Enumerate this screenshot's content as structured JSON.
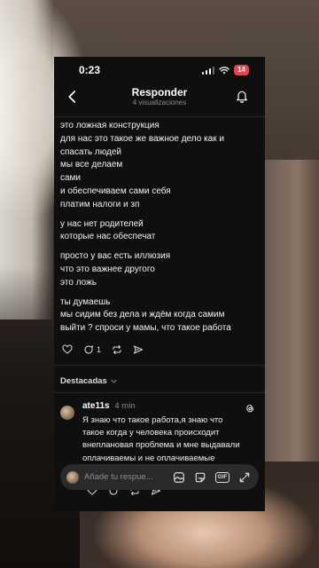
{
  "status_bar": {
    "time": "0:23",
    "battery": "14"
  },
  "header": {
    "title": "Responder",
    "subtitle": "4 visualizaciones"
  },
  "post": {
    "paragraphs": [
      [
        "это ложная конструкция",
        "для нас это такое же важное дело как и",
        "спасать людей",
        "мы все делаем",
        "сами",
        "и обеспечиваем сами себя",
        "платим налоги и зп"
      ],
      [
        "у нас нет родителей",
        "которые нас обеспечат"
      ],
      [
        "просто у вас есть иллюзия",
        "что это важнее другого",
        "это ложь"
      ],
      [
        "ты думаешь",
        "мы сидим без дела и ждём когда самим",
        "выйти ? спроси у мамы, что такое работа"
      ]
    ],
    "reply_count": "1"
  },
  "featured_label": "Destacadas",
  "reply": {
    "username": "ate11s",
    "time": "4 min",
    "text": "Я знаю что такое работа,я знаю что такое когда у человека происходит внеплановая проблема и мне выдавали оплачиваемы и не оплачиваемые выходные"
  },
  "composer": {
    "placeholder": "Añade tu respue...",
    "gif_label": "GIF"
  },
  "icons": [
    "chevron-left-icon",
    "bell-icon",
    "heart-icon",
    "comment-icon",
    "repost-icon",
    "send-icon",
    "threads-icon",
    "image-icon",
    "sticker-icon",
    "gif-icon",
    "expand-icon",
    "wifi-icon",
    "signal-icon"
  ],
  "colors": {
    "background": "#0f0f0f",
    "text": "#f2f2f2",
    "muted": "#8c8c8c",
    "battery": "#e0464c"
  }
}
